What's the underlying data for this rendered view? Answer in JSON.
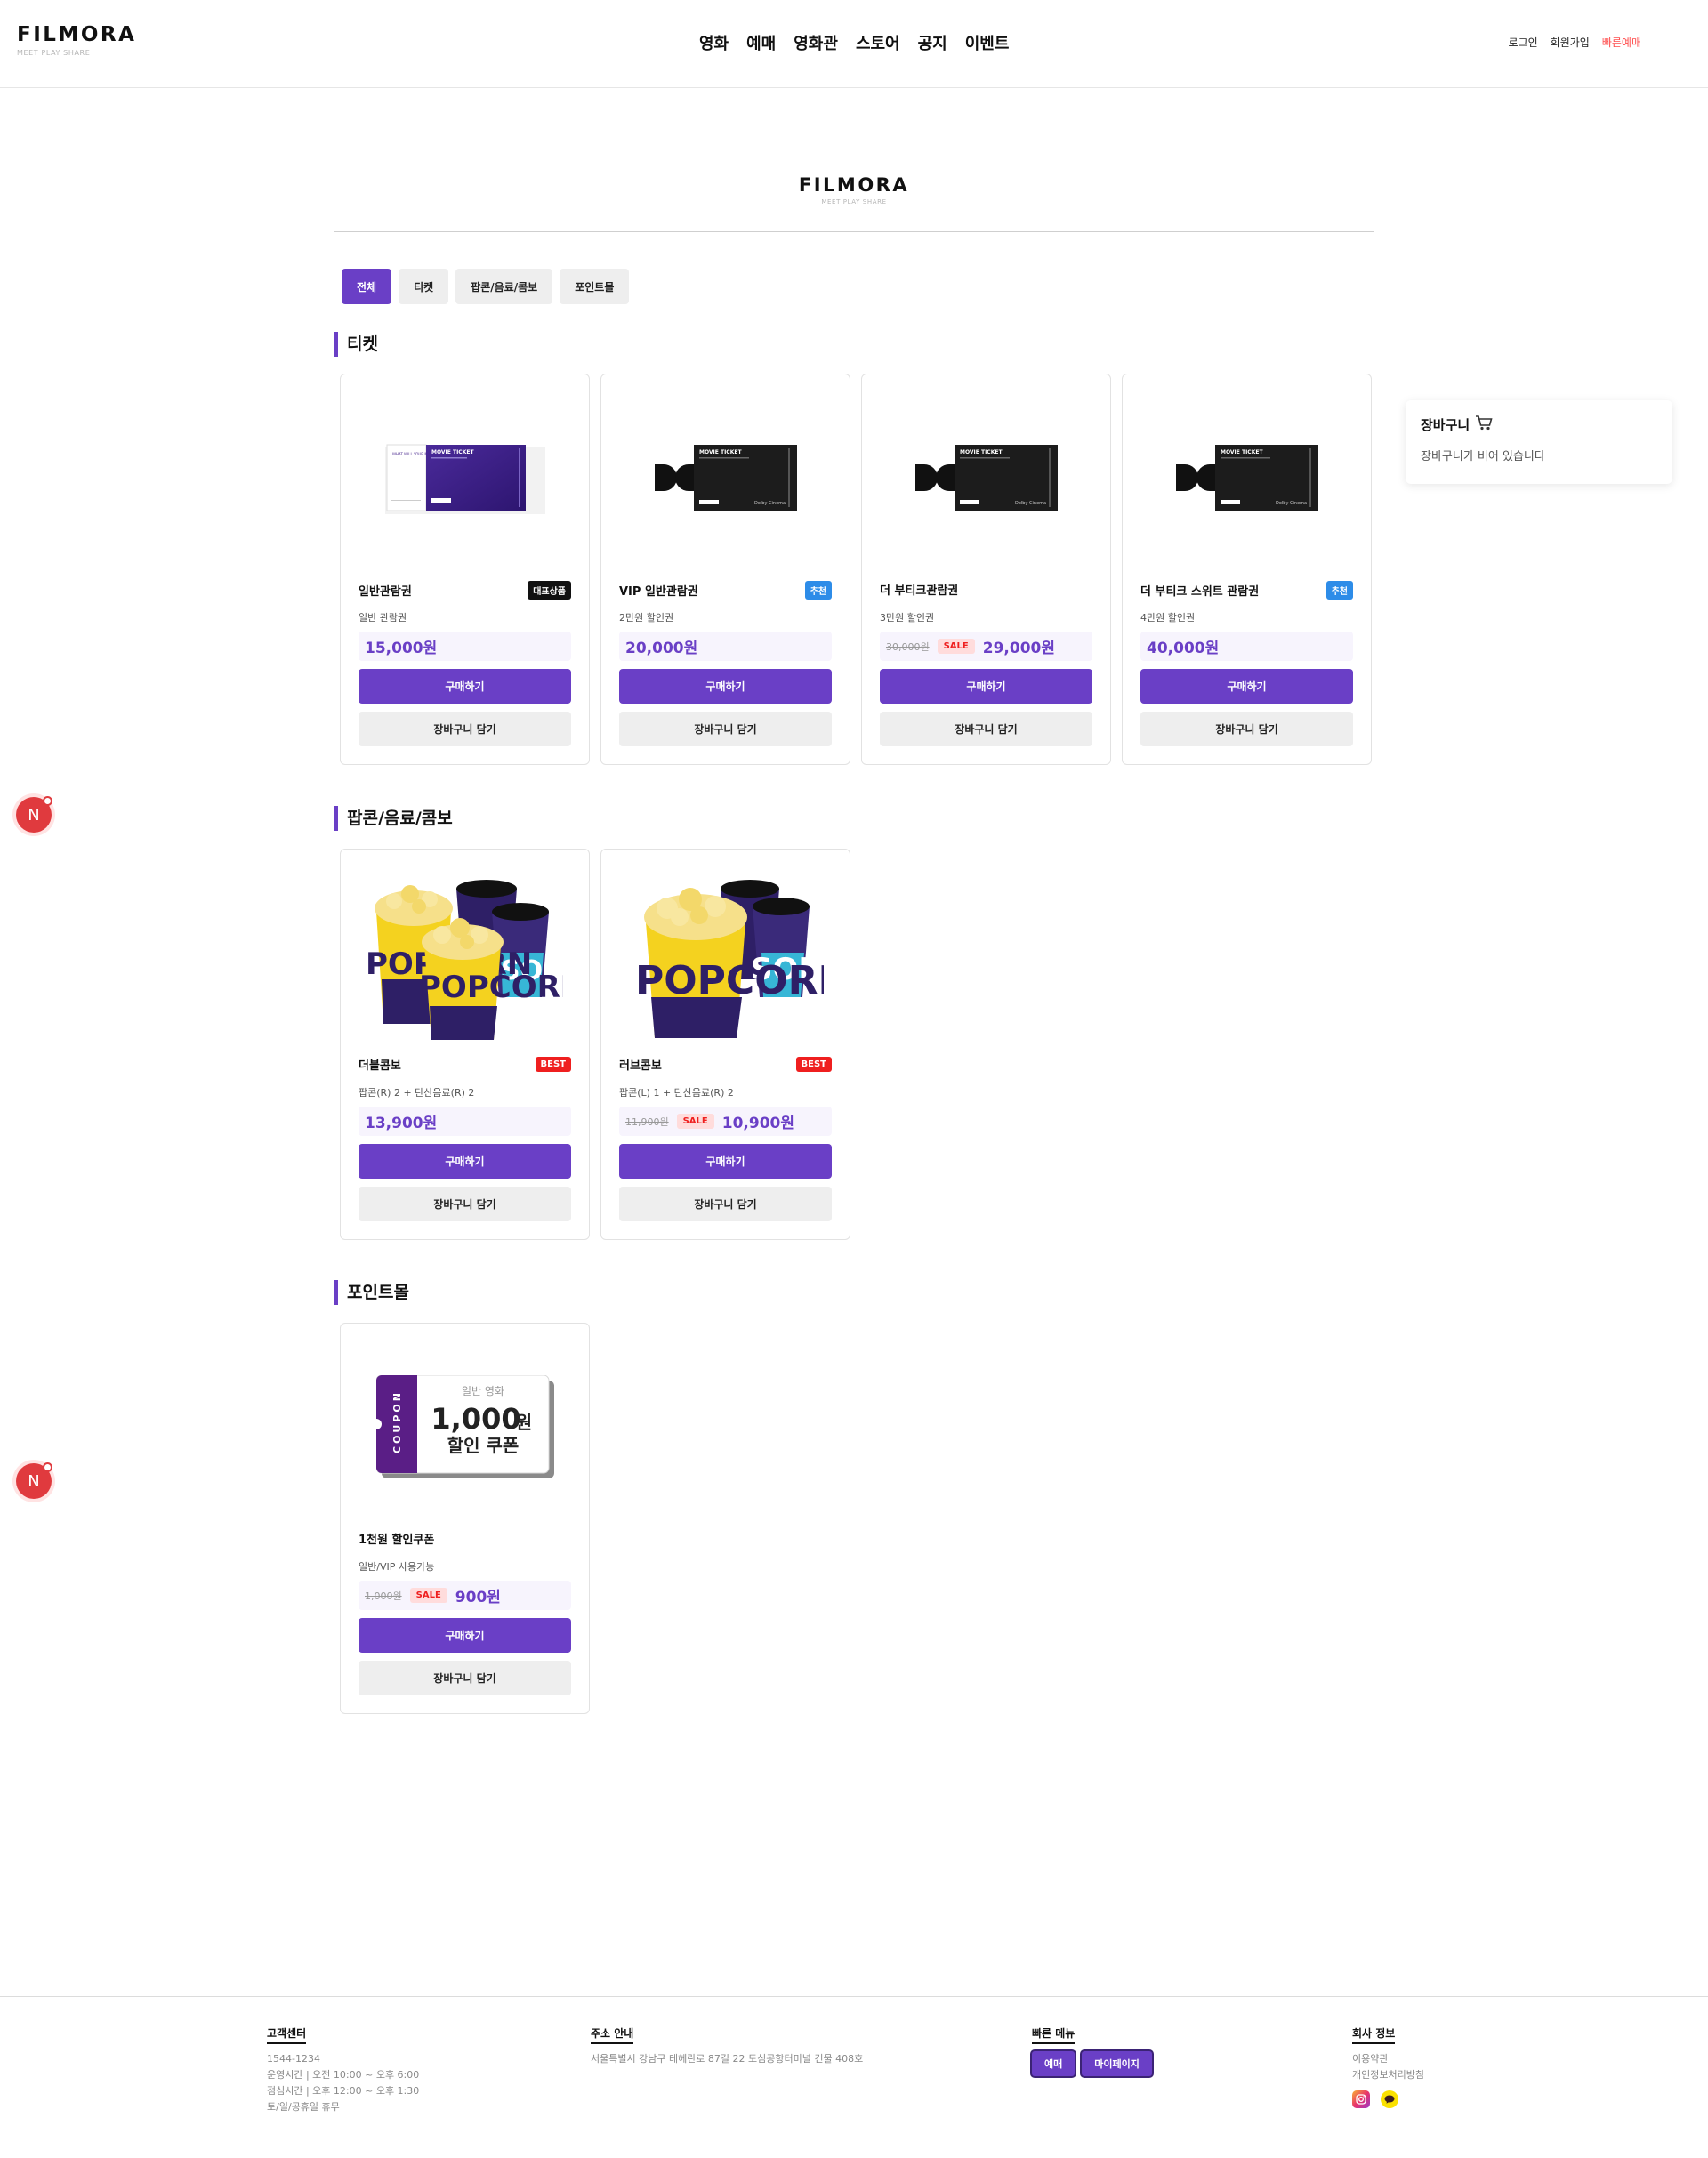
{
  "brand": {
    "name": "FILMORA",
    "tagline": "MEET PLAY SHARE"
  },
  "nav": {
    "items": [
      {
        "label": "영화"
      },
      {
        "label": "예매"
      },
      {
        "label": "영화관"
      },
      {
        "label": "스토어"
      },
      {
        "label": "공지"
      },
      {
        "label": "이벤트"
      }
    ],
    "login": "로그인",
    "signup": "회원가입",
    "quick_booking": "빠른예매"
  },
  "tabs": [
    {
      "label": "전체",
      "active": true
    },
    {
      "label": "티켓",
      "active": false
    },
    {
      "label": "팝콘/음료/콤보",
      "active": false
    },
    {
      "label": "포인트몰",
      "active": false
    }
  ],
  "sections": [
    {
      "title": "티켓",
      "products": [
        {
          "name": "일반관람권",
          "badge": "대표상품",
          "desc": "일반 관람권",
          "original_price": "",
          "sale_label": "",
          "price": "15,000원",
          "buy": "구매하기",
          "cart": "장바구니 담기",
          "image": "movie-ticket-purple"
        },
        {
          "name": "VIP 일반관람권",
          "badge": "추천",
          "desc": "2만원 할인권",
          "original_price": "",
          "sale_label": "",
          "price": "20,000원",
          "buy": "구매하기",
          "cart": "장바구니 담기",
          "image": "movie-ticket-dolby"
        },
        {
          "name": "더 부티크관람권",
          "badge": "",
          "desc": "3만원 할인권",
          "original_price": "30,000원",
          "sale_label": "SALE",
          "price": "29,000원",
          "buy": "구매하기",
          "cart": "장바구니 담기",
          "image": "movie-ticket-dolby"
        },
        {
          "name": "더 부티크 스위트 관람권",
          "badge": "추천",
          "desc": "4만원 할인권",
          "original_price": "",
          "sale_label": "",
          "price": "40,000원",
          "buy": "구매하기",
          "cart": "장바구니 담기",
          "image": "movie-ticket-dolby"
        }
      ]
    },
    {
      "title": "팝콘/음료/콤보",
      "products": [
        {
          "name": "더블콤보",
          "badge": "BEST",
          "desc": "팝콘(R) 2 + 탄산음료(R) 2",
          "original_price": "",
          "sale_label": "",
          "price": "13,900원",
          "buy": "구매하기",
          "cart": "장바구니 담기",
          "image": "popcorn-double-combo"
        },
        {
          "name": "러브콤보",
          "badge": "BEST",
          "desc": "팝콘(L) 1 + 탄산음료(R) 2",
          "original_price": "11,900원",
          "sale_label": "SALE",
          "price": "10,900원",
          "buy": "구매하기",
          "cart": "장바구니 담기",
          "image": "popcorn-love-combo"
        }
      ]
    },
    {
      "title": "포인트몰",
      "products": [
        {
          "name": "1천원 할인쿠폰",
          "badge": "",
          "desc": "일반/VIP 사용가능",
          "original_price": "1,000원",
          "sale_label": "SALE",
          "price": "900원",
          "buy": "구매하기",
          "cart": "장바구니 담기",
          "image": "coupon"
        }
      ]
    }
  ],
  "ticket_art": {
    "ticket_title": "MOVIE TICKET",
    "purple_stub_text": "WHAT WILL YOUR MOVIE BE?",
    "dolby_label": "Dolby Cinema"
  },
  "coupon_art": {
    "stub": "COUPON",
    "line1": "일반 영화",
    "amount": "1,000",
    "unit": "원",
    "line3": "할인 쿠폰"
  },
  "popcorn_art": {
    "text": "POPCORN",
    "soda_text": "SODA"
  },
  "cart": {
    "title": "장바구니",
    "icon": "shopping-cart-icon",
    "empty": "장바구니가 비어 있습니다"
  },
  "footer": {
    "support": {
      "title": "고객센터",
      "lines": [
        "1544-1234",
        "운영시간 | 오전 10:00 ~ 오후 6:00",
        "점심시간 | 오후 12:00 ~ 오후 1:30",
        "토/일/공휴일 휴무"
      ]
    },
    "address": {
      "title": "주소 안내",
      "line": "서울특별시 강남구 테헤란로 87길 22 도심공항터미널 건물 408호"
    },
    "quick": {
      "title": "빠른 메뉴",
      "buttons": [
        "예매",
        "마이페이지"
      ]
    },
    "company": {
      "title": "회사 정보",
      "links": [
        "이용약관",
        "개인정보처리방침"
      ],
      "sns": [
        "instagram-icon",
        "kakaotalk-icon"
      ]
    }
  },
  "floating": {
    "label": "N"
  },
  "colors": {
    "accent": "#6a3fc6",
    "sale": "#ef1f1f",
    "quick_booking": "#ff4d4d",
    "badge_blue": "#2d8ce8"
  }
}
